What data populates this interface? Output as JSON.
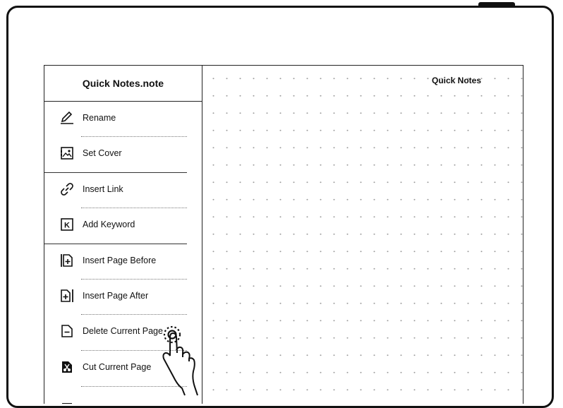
{
  "header": {
    "title": "Quick Notes.note"
  },
  "canvas": {
    "title": "Quick Notes"
  },
  "menu": {
    "items": [
      {
        "label": "Rename",
        "icon": "pencil-icon"
      },
      {
        "label": "Set Cover",
        "icon": "cover-image-icon"
      },
      {
        "label": "Insert Link",
        "icon": "link-icon"
      },
      {
        "label": "Add Keyword",
        "icon": "keyword-k-icon"
      },
      {
        "label": "Insert Page Before",
        "icon": "insert-page-before-icon"
      },
      {
        "label": "Insert Page After",
        "icon": "insert-page-after-icon"
      },
      {
        "label": "Delete Current Page",
        "icon": "delete-page-icon"
      },
      {
        "label": "Cut Current Page",
        "icon": "cut-page-icon"
      }
    ]
  },
  "gesture": {
    "icon": "tap-hand-icon"
  }
}
